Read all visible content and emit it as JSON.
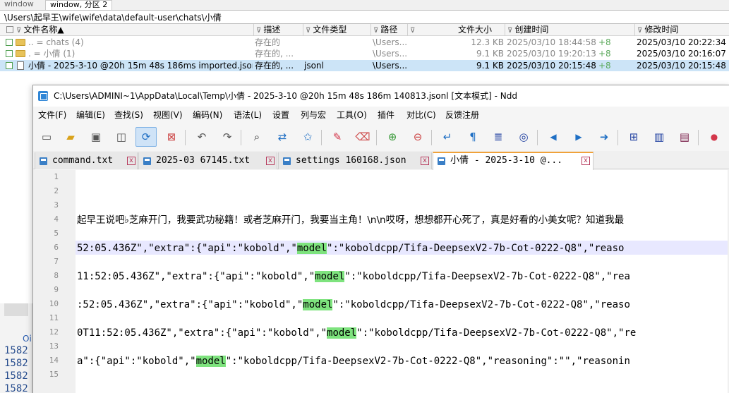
{
  "file_manager": {
    "tabs": [
      "window",
      "window, 分区 2"
    ],
    "path": "\\Users\\起早王\\wife\\wife\\data\\default-user\\chats\\小倩",
    "columns": [
      "文件名称",
      "描述",
      "文件类型",
      "路径",
      "文件大小",
      "创建时间",
      "修改时间"
    ],
    "sort_arrow": "▲",
    "filter_glyph": "⊽",
    "rows": [
      {
        "name": ".. = chats (4)",
        "desc": "存在的",
        "type": "",
        "path": "\\Users...",
        "size": "12.3 KB",
        "created": "2025/03/10  18:44:58",
        "created_offset": "+8",
        "modified": "2025/03/10  20:22:34"
      },
      {
        "name": ". = 小倩 (1)",
        "desc": "存在的, ...",
        "type": "",
        "path": "\\Users...",
        "size": "9.1 KB",
        "created": "2025/03/10  19:20:13",
        "created_offset": "+8",
        "modified": "2025/03/10  20:16:07"
      },
      {
        "name": "小倩 - 2025-3-10 @20h 15m 48s 186ms imported.jsonl",
        "desc": "存在的, ...",
        "type": "jsonl",
        "path": "\\Users...",
        "size": "9.1 KB",
        "created": "2025/03/10  20:15:48",
        "created_offset": "+8",
        "modified": "2025/03/10  20:15:48"
      }
    ],
    "left_panel": {
      "header": "Oi",
      "numbers": [
        "1582",
        "1582",
        "1582",
        "1582"
      ]
    }
  },
  "editor": {
    "title": "C:\\Users\\ADMINI~1\\AppData\\Local\\Temp\\小倩 - 2025-3-10 @20h 15m 48s 186m 140813.jsonl [文本模式] - Ndd",
    "menu": [
      "文件(F)",
      "编辑(E)",
      "查找(S)",
      "视图(V)",
      "编码(N)",
      "语法(L)",
      "设置",
      "列与宏",
      "工具(O)",
      "插件",
      "对比(C)",
      "反馈注册"
    ],
    "toolbar": [
      {
        "icon": "new-file-icon",
        "glyph": "▭"
      },
      {
        "icon": "open-folder-icon",
        "glyph": "▰"
      },
      {
        "icon": "save-icon",
        "glyph": "▣"
      },
      {
        "icon": "save-all-icon",
        "glyph": "◫"
      },
      {
        "icon": "reload-icon",
        "glyph": "⟳"
      },
      {
        "icon": "close-file-icon",
        "glyph": "⊠"
      },
      {
        "icon": "undo-icon",
        "glyph": "↶"
      },
      {
        "icon": "redo-icon",
        "glyph": "↷"
      },
      {
        "icon": "binoculars-icon",
        "glyph": "⌕"
      },
      {
        "icon": "replace-icon",
        "glyph": "⇄"
      },
      {
        "icon": "bookmark-icon",
        "glyph": "✩"
      },
      {
        "icon": "marker-icon",
        "glyph": "✎"
      },
      {
        "icon": "eraser-icon",
        "glyph": "⌫"
      },
      {
        "icon": "zoom-in-icon",
        "glyph": "⊕"
      },
      {
        "icon": "zoom-out-icon",
        "glyph": "⊖"
      },
      {
        "icon": "word-wrap-icon",
        "glyph": "↵"
      },
      {
        "icon": "show-symbols-icon",
        "glyph": "¶"
      },
      {
        "icon": "indent-guide-icon",
        "glyph": "≣"
      },
      {
        "icon": "target-icon",
        "glyph": "◎"
      },
      {
        "icon": "prev-icon",
        "glyph": "◀"
      },
      {
        "icon": "next-icon",
        "glyph": "▶"
      },
      {
        "icon": "goto-icon",
        "glyph": "➜"
      },
      {
        "icon": "split-h-icon",
        "glyph": "⊞"
      },
      {
        "icon": "split-v-icon",
        "glyph": "▥"
      },
      {
        "icon": "monitor-icon",
        "glyph": "▤"
      },
      {
        "icon": "record-icon",
        "glyph": "●"
      }
    ],
    "tabs": [
      {
        "label": "command.txt",
        "active": false
      },
      {
        "label": "2025-03 67145.txt",
        "active": false
      },
      {
        "label": "settings 160168.json",
        "active": false
      },
      {
        "label": "小倩 - 2025-3-10 @...",
        "active": true
      }
    ],
    "close_glyph": "x",
    "line_numbers": [
      "1",
      "2",
      "3",
      "4",
      "5",
      "6",
      "7",
      "8",
      "9",
      "10",
      "11",
      "12",
      "13",
      "14",
      "15"
    ],
    "current_line": "6",
    "lines": [
      {
        "n": "4",
        "type": "cjk",
        "text": "起早王说吧♭芝麻开门，我要武功秘籍！或者芝麻开门，我要当主角！\\n\\n哎呀，想想都开心死了，真是好看的小美女呢？知道我最"
      },
      {
        "n": "6",
        "pre": "52:05.436Z\",\"extra\":{\"api\":\"kobold\",\"",
        "hl": "model",
        "post": "\":\"koboldcpp/Tifa-DeepsexV2-7b-Cot-0222-Q8\",\"reaso"
      },
      {
        "n": "8",
        "pre": "11:52:05.436Z\",\"extra\":{\"api\":\"kobold\",\"",
        "hl": "model",
        "post": "\":\"koboldcpp/Tifa-DeepsexV2-7b-Cot-0222-Q8\",\"rea"
      },
      {
        "n": "10",
        "pre": ":52:05.436Z\",\"extra\":{\"api\":\"kobold\",\"",
        "hl": "model",
        "post": "\":\"koboldcpp/Tifa-DeepsexV2-7b-Cot-0222-Q8\",\"reaso"
      },
      {
        "n": "12",
        "pre": "0T11:52:05.436Z\",\"extra\":{\"api\":\"kobold\",\"",
        "hl": "model",
        "post": "\":\"koboldcpp/Tifa-DeepsexV2-7b-Cot-0222-Q8\",\"re"
      },
      {
        "n": "14",
        "pre": "a\":{\"api\":\"kobold\",\"",
        "hl": "model",
        "post": "\":\"koboldcpp/Tifa-DeepsexV2-7b-Cot-0222-Q8\",\"reasoning\":\"\",\"reasonin"
      }
    ]
  },
  "colors": {
    "selected_row": "#cce4f7",
    "active_tab_accent": "#f0a23a",
    "search_highlight": "#7ee37e",
    "current_line": "#e8e8ff"
  }
}
